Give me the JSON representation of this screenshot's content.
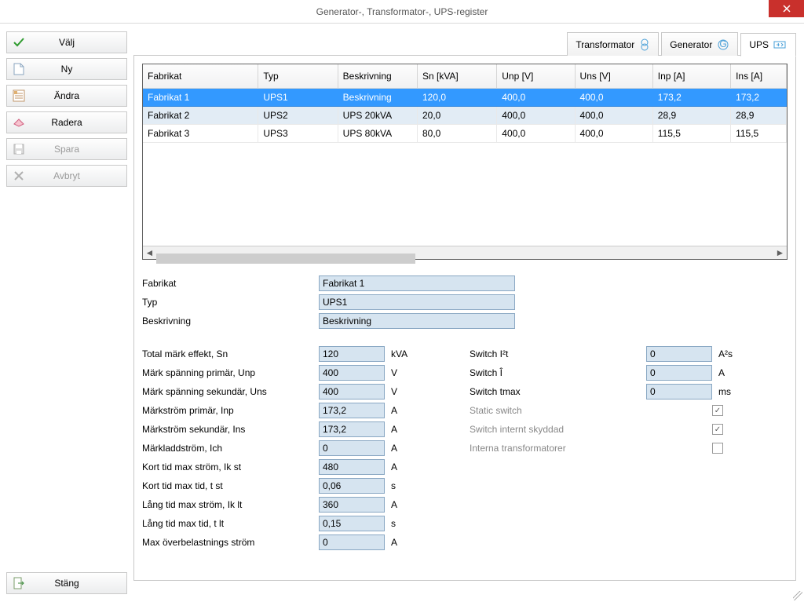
{
  "window": {
    "title": "Generator-, Transformator-, UPS-register"
  },
  "sidebar": {
    "valj": "Välj",
    "ny": "Ny",
    "andra": "Ändra",
    "radera": "Radera",
    "spara": "Spara",
    "avbryt": "Avbryt",
    "stang": "Stäng"
  },
  "tabs": {
    "transformator": "Transformator",
    "generator": "Generator",
    "ups": "UPS"
  },
  "table": {
    "headers": {
      "fabrikat": "Fabrikat",
      "typ": "Typ",
      "beskrivning": "Beskrivning",
      "sn": "Sn [kVA]",
      "unp": "Unp [V]",
      "uns": "Uns [V]",
      "inp": "Inp [A]",
      "ins": "Ins [A]"
    },
    "rows": [
      {
        "fabrikat": "Fabrikat 1",
        "typ": "UPS1",
        "beskrivning": "Beskrivning",
        "sn": "120,0",
        "unp": "400,0",
        "uns": "400,0",
        "inp": "173,2",
        "ins": "173,2"
      },
      {
        "fabrikat": "Fabrikat 2",
        "typ": "UPS2",
        "beskrivning": "UPS 20kVA",
        "sn": "20,0",
        "unp": "400,0",
        "uns": "400,0",
        "inp": "28,9",
        "ins": "28,9"
      },
      {
        "fabrikat": "Fabrikat 3",
        "typ": "UPS3",
        "beskrivning": "UPS 80kVA",
        "sn": "80,0",
        "unp": "400,0",
        "uns": "400,0",
        "inp": "115,5",
        "ins": "115,5"
      }
    ]
  },
  "form": {
    "labels": {
      "fabrikat": "Fabrikat",
      "typ": "Typ",
      "beskrivning": "Beskrivning",
      "sn": "Total märk effekt, Sn",
      "unp": "Märk spänning primär, Unp",
      "uns": "Märk spänning sekundär, Uns",
      "inp": "Märkström primär, Inp",
      "ins": "Märkström sekundär, Ins",
      "ich": "Märkladdström, Ich",
      "ikst": "Kort tid max ström, Ik st",
      "tst": "Kort tid max tid, t st",
      "iklt": "Lång tid max ström, Ik lt",
      "tlt": "Lång tid max tid, t lt",
      "maxov": "Max överbelastnings ström",
      "switch_i2t": "Switch I²t",
      "switch_i": "Switch Î",
      "switch_tmax": "Switch tmax",
      "static_switch": "Static switch",
      "switch_int_prot": "Switch internt skyddad",
      "int_trans": "Interna transformatorer"
    },
    "units": {
      "kva": "kVA",
      "v": "V",
      "a": "A",
      "s": "s",
      "a2s": "A²s",
      "ms": "ms"
    },
    "values": {
      "fabrikat": "Fabrikat 1",
      "typ": "UPS1",
      "beskrivning": "Beskrivning",
      "sn": "120",
      "unp": "400",
      "uns": "400",
      "inp": "173,2",
      "ins": "173,2",
      "ich": "0",
      "ikst": "480",
      "tst": "0,06",
      "iklt": "360",
      "tlt": "0,15",
      "maxov": "0",
      "switch_i2t": "0",
      "switch_i": "0",
      "switch_tmax": "0",
      "static_switch": true,
      "switch_int_prot": true,
      "int_trans": false
    }
  }
}
